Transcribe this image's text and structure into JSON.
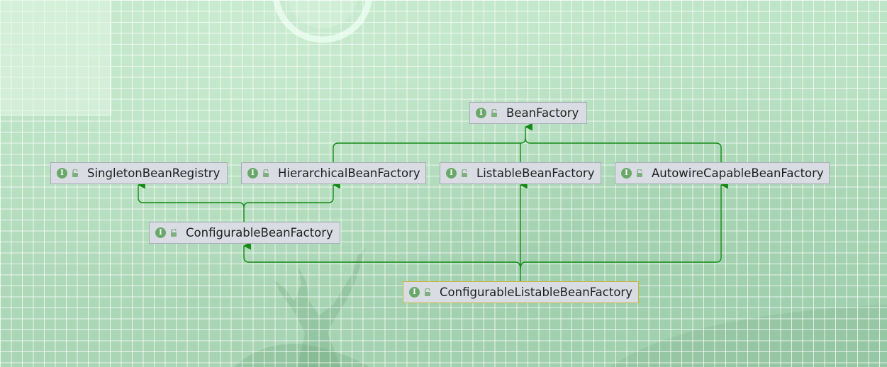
{
  "diagram": {
    "nodes": [
      {
        "id": "bean-factory",
        "label": "BeanFactory",
        "icon": "interface-icon",
        "access_icon": "public-lock-icon"
      },
      {
        "id": "singleton-bean-registry",
        "label": "SingletonBeanRegistry",
        "icon": "interface-icon",
        "access_icon": "public-lock-icon"
      },
      {
        "id": "hierarchical-bean-factory",
        "label": "HierarchicalBeanFactory",
        "icon": "interface-icon",
        "access_icon": "public-lock-icon"
      },
      {
        "id": "listable-bean-factory",
        "label": "ListableBeanFactory",
        "icon": "interface-icon",
        "access_icon": "public-lock-icon"
      },
      {
        "id": "autowire-capable-bean-factory",
        "label": "AutowireCapableBeanFactory",
        "icon": "interface-icon",
        "access_icon": "public-lock-icon"
      },
      {
        "id": "configurable-bean-factory",
        "label": "ConfigurableBeanFactory",
        "icon": "interface-icon",
        "access_icon": "public-lock-icon"
      },
      {
        "id": "configurable-listable-bean-factory",
        "label": "ConfigurableListableBeanFactory",
        "icon": "interface-icon",
        "access_icon": "public-lock-icon",
        "selected": true
      }
    ],
    "edges": [
      {
        "from": "hierarchical-bean-factory",
        "to": "bean-factory",
        "kind": "extends"
      },
      {
        "from": "listable-bean-factory",
        "to": "bean-factory",
        "kind": "extends"
      },
      {
        "from": "autowire-capable-bean-factory",
        "to": "bean-factory",
        "kind": "extends"
      },
      {
        "from": "configurable-bean-factory",
        "to": "singleton-bean-registry",
        "kind": "extends"
      },
      {
        "from": "configurable-bean-factory",
        "to": "hierarchical-bean-factory",
        "kind": "extends"
      },
      {
        "from": "configurable-listable-bean-factory",
        "to": "configurable-bean-factory",
        "kind": "extends"
      },
      {
        "from": "configurable-listable-bean-factory",
        "to": "listable-bean-factory",
        "kind": "extends"
      },
      {
        "from": "configurable-listable-bean-factory",
        "to": "autowire-capable-bean-factory",
        "kind": "extends"
      }
    ],
    "interface_badge_letter": "I",
    "colors": {
      "edge": "#138a13",
      "node_fill": "#d9dde3",
      "node_border": "#a7adb5",
      "selected_border": "#c9b33e",
      "interface_badge": "#6aa86a",
      "lock": "#7fae7f"
    }
  }
}
